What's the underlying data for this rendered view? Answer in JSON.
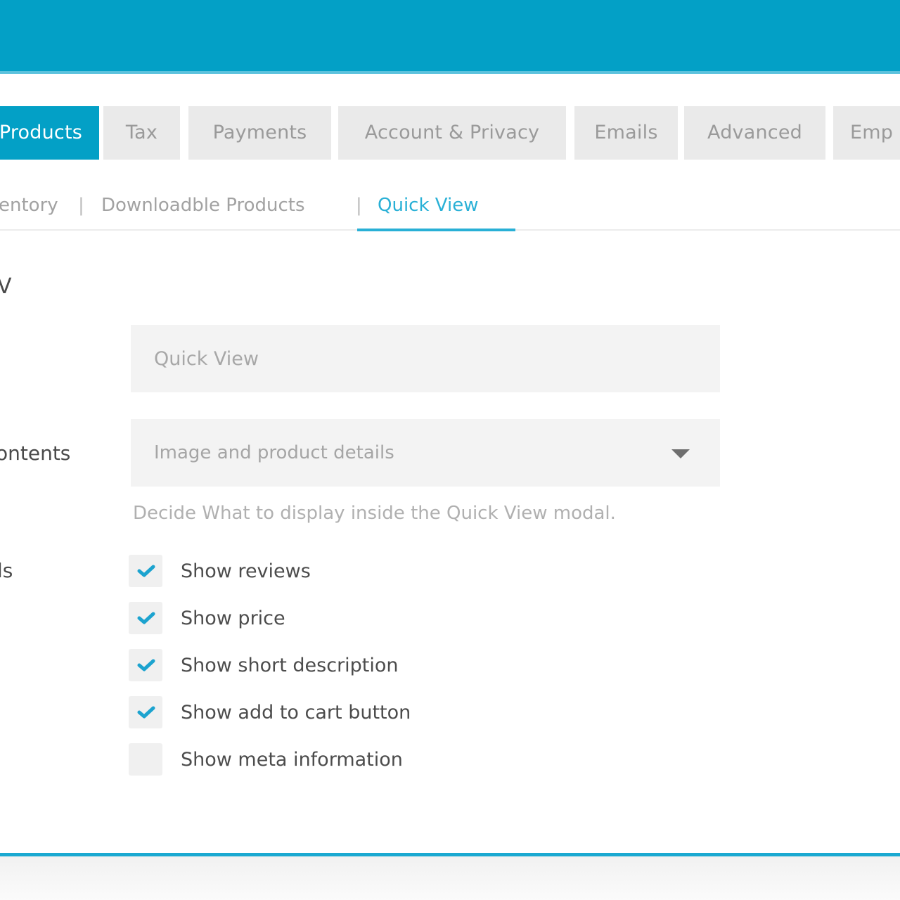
{
  "colors": {
    "accent": "#03a0c6",
    "tab_inactive_bg": "#eaeaea",
    "field_bg": "#f3f3f3",
    "check_color": "#1ca3cf"
  },
  "tabs": [
    {
      "label": "Products",
      "active": true
    },
    {
      "label": "Tax",
      "active": false
    },
    {
      "label": "Payments",
      "active": false
    },
    {
      "label": "Account & Privacy",
      "active": false
    },
    {
      "label": "Emails",
      "active": false
    },
    {
      "label": "Advanced",
      "active": false
    },
    {
      "label": "Emp",
      "active": false
    }
  ],
  "subnav": {
    "items": [
      {
        "label": "entory",
        "active": false
      },
      {
        "label": "Downloadble Products",
        "active": false
      },
      {
        "label": "Quick View",
        "active": true
      }
    ],
    "separator": "|"
  },
  "section": {
    "title": "V"
  },
  "fields": {
    "label_input": {
      "label": "",
      "placeholder": "Quick View"
    },
    "contents": {
      "label": "ontents",
      "value": "Image and product details",
      "help": "Decide What to display inside the Quick View modal."
    },
    "details": {
      "label": "ls",
      "options": [
        {
          "label": "Show reviews",
          "checked": true
        },
        {
          "label": "Show price",
          "checked": true
        },
        {
          "label": "Show short description",
          "checked": true
        },
        {
          "label": "Show add to cart button",
          "checked": true
        },
        {
          "label": "Show meta information",
          "checked": false
        }
      ]
    }
  }
}
